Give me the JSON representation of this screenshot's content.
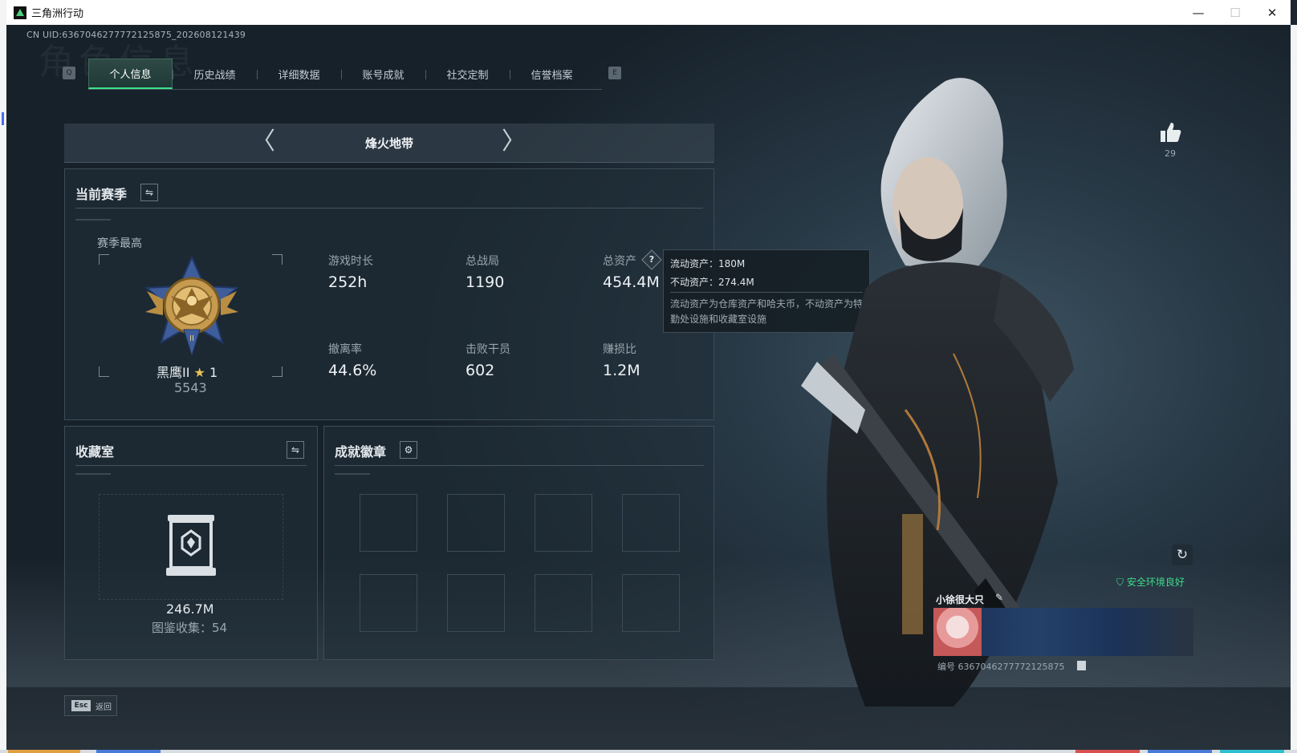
{
  "window": {
    "title": "三角洲行动",
    "minimize": "—",
    "maximize": "☐",
    "close": "✕"
  },
  "uid_text": "CN UID:6367046277772125875_202608121439",
  "bg_title": "角色信息",
  "tabs": {
    "left_key": "Q",
    "right_key": "E",
    "items": [
      {
        "label": "个人信息",
        "active": true
      },
      {
        "label": "历史战绩"
      },
      {
        "label": "详细数据"
      },
      {
        "label": "账号成就"
      },
      {
        "label": "社交定制"
      },
      {
        "label": "信誉档案"
      }
    ]
  },
  "mode": {
    "title": "烽火地带",
    "prev": "〈",
    "next": "〉"
  },
  "season": {
    "title": "当前赛季",
    "switch_icon": "⇋",
    "best_label": "赛季最高",
    "rank_name": "黑鹰II",
    "rank_star": "★",
    "rank_stars": "1",
    "rank_score": "5543",
    "stats": [
      {
        "label": "游戏时长",
        "value": "252h"
      },
      {
        "label": "总战局",
        "value": "1190"
      },
      {
        "label": "总资产",
        "value": "454.4M"
      },
      {
        "label": "撤离率",
        "value": "44.6%"
      },
      {
        "label": "击败干员",
        "value": "602"
      },
      {
        "label": "赚损比",
        "value": "1.2M"
      }
    ],
    "help_icon": "?"
  },
  "tooltip": {
    "liquid": "流动资产：180M",
    "fixed": "不动资产：274.4M",
    "note": "流动资产为仓库资产和哈夫币，不动资产为特勤处设施和收藏室设施"
  },
  "collection": {
    "title": "收藏室",
    "switch_icon": "⇋",
    "value": "246.7M",
    "count": "图鉴收集：54"
  },
  "badges": {
    "title": "成就徽章",
    "settings_icon": "⚙"
  },
  "profile": {
    "likes": "29",
    "refresh_icon": "↻",
    "safe_status": "安全环境良好",
    "name": "小徐很大只",
    "edit_icon": "✎",
    "id_text": "编号 6367046277772125875"
  },
  "bottom": {
    "esc_key": "Esc",
    "esc_label": "返回"
  },
  "colors": {
    "accent_green": "#3ce28a",
    "safe_green": "#3fd98a",
    "background": "#1b2630"
  }
}
